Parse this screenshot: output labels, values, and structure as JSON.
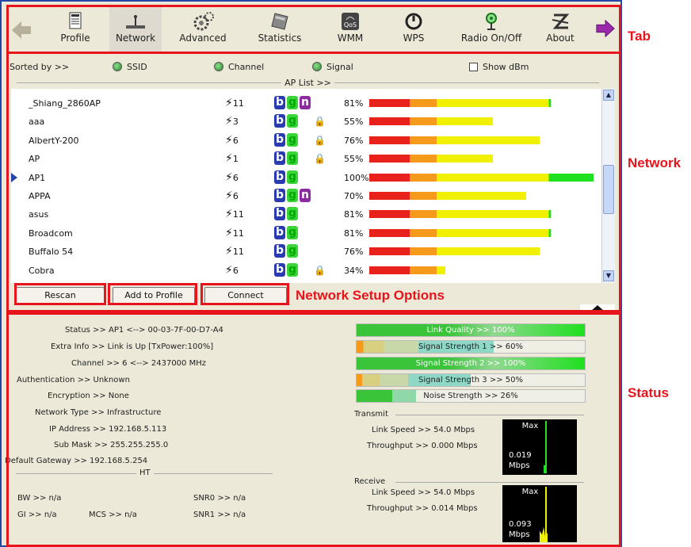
{
  "tabs": [
    {
      "label": "Profile",
      "icon": "profile-icon"
    },
    {
      "label": "Network",
      "icon": "network-icon"
    },
    {
      "label": "Advanced",
      "icon": "gears-icon"
    },
    {
      "label": "Statistics",
      "icon": "calculator-icon"
    },
    {
      "label": "WMM",
      "icon": "qos-icon"
    },
    {
      "label": "WPS",
      "icon": "wps-icon"
    },
    {
      "label": "Radio On/Off",
      "icon": "radio-antenna-icon"
    },
    {
      "label": "About",
      "icon": "about-icon"
    }
  ],
  "annotations": {
    "tab": "Tab",
    "network": "Network",
    "options": "Network Setup Options",
    "status": "Status"
  },
  "sort": {
    "label": "Sorted by >>",
    "ssid": "SSID",
    "channel": "Channel",
    "signal": "Signal",
    "show_dbm": "Show dBm"
  },
  "ap_list_title": "AP List >>",
  "networks": [
    {
      "ssid": "_Shiang_2860AP",
      "channel": "11",
      "modes": [
        "b",
        "g",
        "n"
      ],
      "lock": false,
      "signal": "81%"
    },
    {
      "ssid": "aaa",
      "channel": "3",
      "modes": [
        "b",
        "g"
      ],
      "lock": true,
      "signal": "55%"
    },
    {
      "ssid": "AlbertY-200",
      "channel": "6",
      "modes": [
        "b",
        "g"
      ],
      "lock": true,
      "signal": "76%"
    },
    {
      "ssid": "AP",
      "channel": "1",
      "modes": [
        "b",
        "g"
      ],
      "lock": true,
      "signal": "55%"
    },
    {
      "ssid": "AP1",
      "channel": "6",
      "modes": [
        "b",
        "g"
      ],
      "lock": false,
      "signal": "100%",
      "selected": true
    },
    {
      "ssid": "APPA",
      "channel": "6",
      "modes": [
        "b",
        "g",
        "n"
      ],
      "lock": false,
      "signal": "70%"
    },
    {
      "ssid": "asus",
      "channel": "11",
      "modes": [
        "b",
        "g"
      ],
      "lock": false,
      "signal": "81%"
    },
    {
      "ssid": "Broadcom",
      "channel": "11",
      "modes": [
        "b",
        "g"
      ],
      "lock": false,
      "signal": "81%"
    },
    {
      "ssid": "Buffalo 54",
      "channel": "11",
      "modes": [
        "b",
        "g"
      ],
      "lock": false,
      "signal": "76%"
    },
    {
      "ssid": "Cobra",
      "channel": "6",
      "modes": [
        "b",
        "g"
      ],
      "lock": true,
      "signal": "34%"
    }
  ],
  "buttons": {
    "rescan": "Rescan",
    "add": "Add to Profile",
    "connect": "Connect"
  },
  "status": {
    "status": "Status >> AP1 <--> 00-03-7F-00-D7-A4",
    "extra": "Extra Info >> Link is Up [TxPower:100%]",
    "channel": "Channel >> 6 <--> 2437000 MHz",
    "auth": "Authentication >> Unknown",
    "enc": "Encryption >> None",
    "nettype": "Network Type >> Infrastructure",
    "ip": "IP Address >> 192.168.5.113",
    "mask": "Sub Mask >> 255.255.255.0",
    "gw": "Default Gateway >> 192.168.5.254",
    "ht": "HT",
    "bw": "BW >> n/a",
    "gi": "GI >> n/a",
    "mcs": "MCS >> n/a",
    "snr0": "SNR0 >> n/a",
    "snr1": "SNR1 >> n/a"
  },
  "quality": [
    {
      "text": "Link Quality >> 100%",
      "level": 1.0
    },
    {
      "text": "Signal Strength 1 >> 60%",
      "level": 0.6
    },
    {
      "text": "Signal Strength 2 >> 100%",
      "level": 1.0
    },
    {
      "text": "Signal Strength 3 >> 50%",
      "level": 0.5
    },
    {
      "text": "Noise Strength >> 26%",
      "level": 0.26
    }
  ],
  "transmit": {
    "title": "Transmit",
    "link": "Link Speed >> 54.0 Mbps",
    "tput": "Throughput >> 0.000 Mbps",
    "max": "Max",
    "value": "0.019",
    "unit": "Mbps"
  },
  "receive": {
    "title": "Receive",
    "link": "Link Speed >> 54.0 Mbps",
    "tput": "Throughput >> 0.014 Mbps",
    "max": "Max",
    "value": "0.093",
    "unit": "Mbps"
  },
  "colors": {
    "green": "#1fe01f",
    "yellow": "#f0f000",
    "orange": "#f59a1a",
    "red": "#e8221b",
    "accent_red": "#e8141c",
    "bg": "#ece9d8"
  }
}
